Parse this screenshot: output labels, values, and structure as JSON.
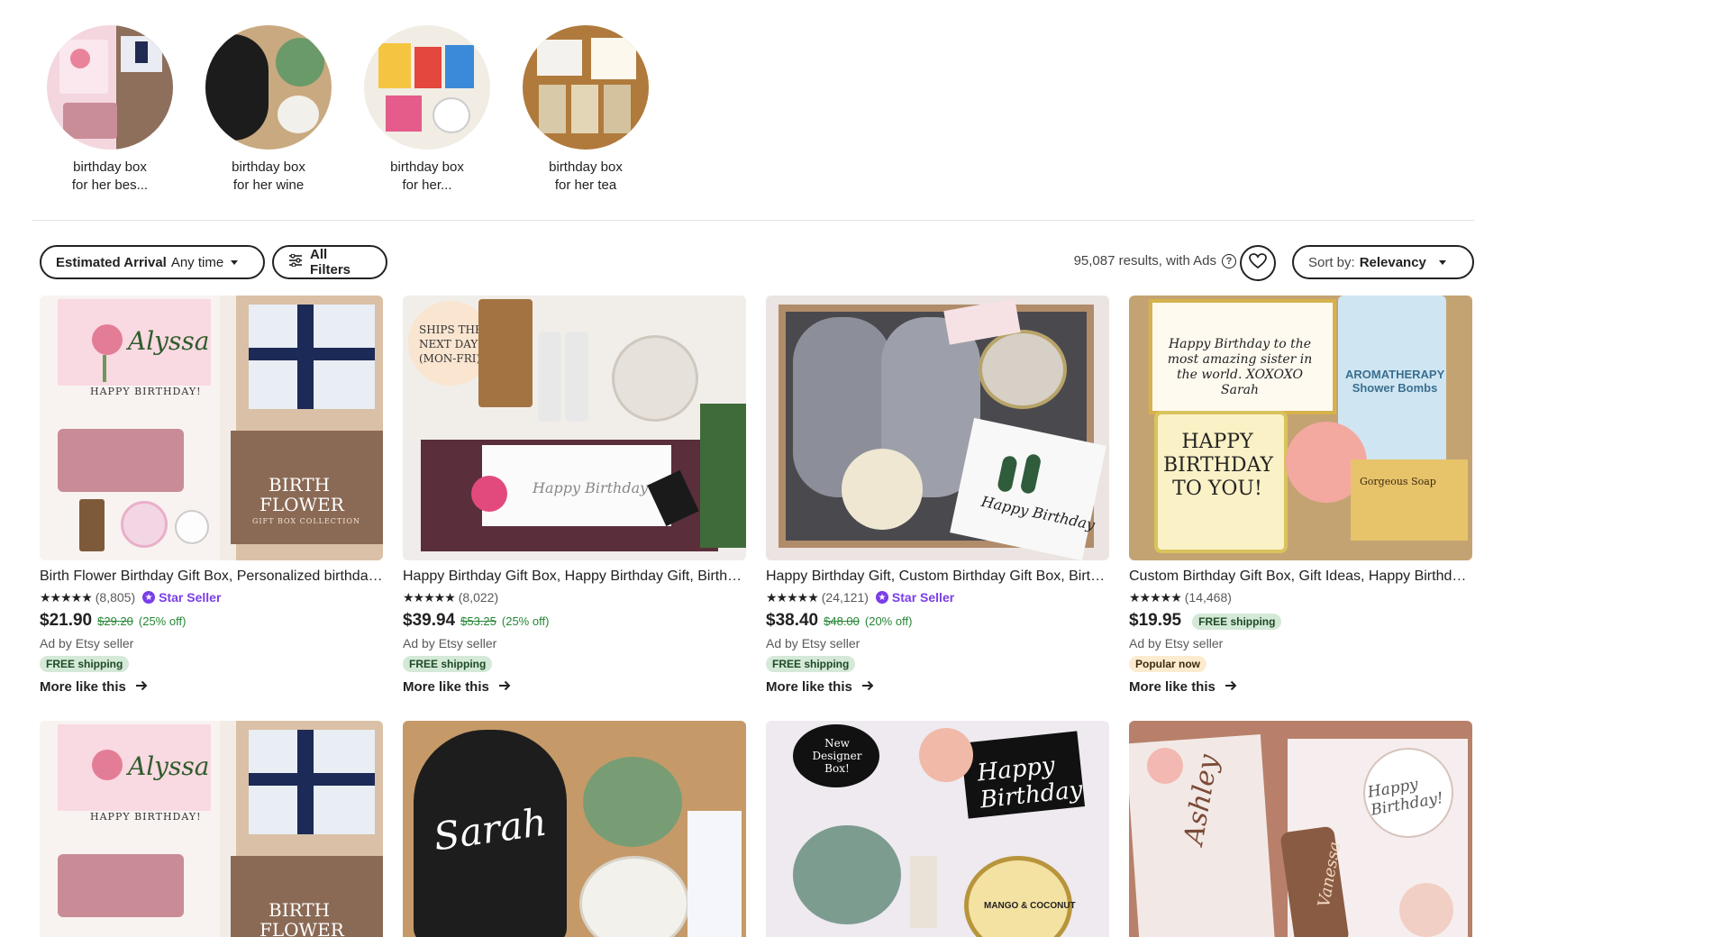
{
  "related_searches": [
    {
      "line1": "birthday box",
      "line2": "for her bes..."
    },
    {
      "line1": "birthday box",
      "line2": "for her wine"
    },
    {
      "line1": "birthday box",
      "line2": "for her..."
    },
    {
      "line1": "birthday box",
      "line2": "for her tea"
    }
  ],
  "filters": {
    "arrival_label": "Estimated Arrival",
    "arrival_value": "Any time",
    "all_filters": "All Filters",
    "results": "95,087 results, with Ads",
    "help_glyph": "?",
    "sort_label": "Sort by:",
    "sort_value": "Relevancy"
  },
  "image_texts": {
    "card1_name": "Alyssa",
    "card1_happy": "HAPPY BIRTHDAY!",
    "card1_birth": "BIRTH",
    "card1_flower": "FLOWER",
    "card1_collection": "GIFT BOX COLLECTION",
    "card2_ships": "SHIPS THE NEXT DAY (MON-FRI)",
    "card2_script": "Happy Birthday",
    "card3_script": "Happy Birthday",
    "card4_note": "Happy Birthday to the most amazing sister in the world. XOXOXO Sarah",
    "card4_candle": "HAPPY BIRTHDAY TO YOU!",
    "card4_bomb": "AROMATHERAPY Shower Bombs",
    "card4_soap": "Gorgeous Soap",
    "row2_sarah": "Sarah",
    "row2_new": "New Designer Box!",
    "row2_script": "Happy Birthday",
    "row2_mango": "MANGO & COCONUT",
    "row2_ashley": "Ashley",
    "row2_vanessa": "Vanessa",
    "row2_hb": "Happy Birthday!"
  },
  "listings": [
    {
      "title": "Birth Flower Birthday Gift Box, Personalized birthday gift box for her",
      "stars": "★★★★★",
      "reviews": "(8,805)",
      "star_seller": "Star Seller",
      "price": "$21.90",
      "original": "$29.20",
      "discount": "(25% off)",
      "ad": "Ad by Etsy seller",
      "badge": "FREE shipping",
      "more": "More like this"
    },
    {
      "title": "Happy Birthday Gift Box, Happy Birthday Gift, Birthday Box for Her",
      "stars": "★★★★★",
      "reviews": "(8,022)",
      "price": "$39.94",
      "original": "$53.25",
      "discount": "(25% off)",
      "ad": "Ad by Etsy seller",
      "badge": "FREE shipping",
      "more": "More like this"
    },
    {
      "title": "Happy Birthday Gift, Custom Birthday Gift Box, Birthday Gift for Her",
      "stars": "★★★★★",
      "reviews": "(24,121)",
      "star_seller": "Star Seller",
      "price": "$38.40",
      "original": "$48.00",
      "discount": "(20% off)",
      "ad": "Ad by Etsy seller",
      "badge": "FREE shipping",
      "more": "More like this"
    },
    {
      "title": "Custom Birthday Gift Box, Gift Ideas, Happy Birthday Box for Sister",
      "stars": "★★★★★",
      "reviews": "(14,468)",
      "price": "$19.95",
      "inline_badge": "FREE shipping",
      "ad": "Ad by Etsy seller",
      "badge": "Popular now",
      "more": "More like this"
    }
  ]
}
